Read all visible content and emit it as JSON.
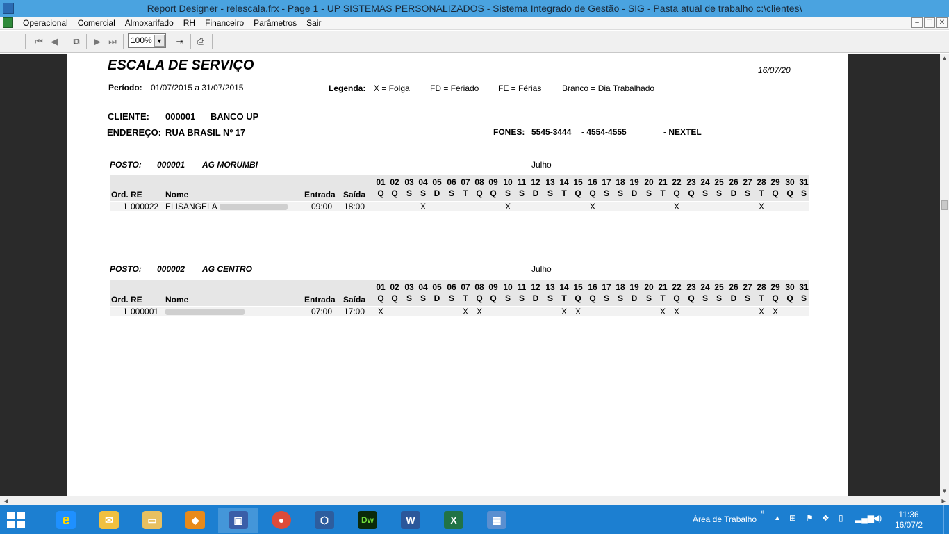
{
  "window": {
    "title": "Report Designer - relescala.frx - Page 1 - UP SISTEMAS PERSONALIZADOS - Sistema Integrado de Gestão - SIG - Pasta atual de trabalho c:\\clientes\\"
  },
  "menu": {
    "items": [
      "Operacional",
      "Comercial",
      "Almoxarifado",
      "RH",
      "Financeiro",
      "Parâmetros",
      "Sair"
    ]
  },
  "toolbar": {
    "zoom": "100%"
  },
  "report": {
    "title": "ESCALA DE SERVIÇO",
    "date": "16/07/20",
    "period_label": "Período:",
    "period_value": "01/07/2015 a 31/07/2015",
    "legend_label": "Legenda:",
    "legend_x": "X = Folga",
    "legend_fd": "FD = Feriado",
    "legend_fe": "FE = Férias",
    "legend_blank": "Branco = Dia Trabalhado",
    "client_label": "CLIENTE:",
    "client_code": "000001",
    "client_name": "BANCO UP",
    "address_label": "ENDEREÇO:",
    "address_value": "RUA BRASIL Nº 17",
    "phones_label": "FONES:",
    "phone_1": "5545-3444",
    "phone_2": "- 4554-4555",
    "phone_3": "- NEXTEL",
    "columns": {
      "ord_re": "Ord. RE",
      "nome": "Nome",
      "entrada": "Entrada",
      "saida": "Saída"
    },
    "days": [
      "01",
      "02",
      "03",
      "04",
      "05",
      "06",
      "07",
      "08",
      "09",
      "10",
      "11",
      "12",
      "13",
      "14",
      "15",
      "16",
      "17",
      "18",
      "19",
      "20",
      "21",
      "22",
      "23",
      "24",
      "25",
      "26",
      "27",
      "28",
      "29",
      "30",
      "31"
    ],
    "weekdays": [
      "Q",
      "Q",
      "S",
      "S",
      "D",
      "S",
      "T",
      "Q",
      "Q",
      "S",
      "S",
      "D",
      "S",
      "T",
      "Q",
      "Q",
      "S",
      "S",
      "D",
      "S",
      "T",
      "Q",
      "Q",
      "S",
      "S",
      "D",
      "S",
      "T",
      "Q",
      "Q",
      "S"
    ],
    "postos": [
      {
        "label": "POSTO:",
        "code": "000001",
        "name": "AG MORUMBI",
        "month": "Julho",
        "row": {
          "ord": "1",
          "re": "000022",
          "nome": "ELISANGELA",
          "entrada": "09:00",
          "saida": "18:00",
          "folga": "X",
          "folga_days": [
            4,
            10,
            16,
            22,
            28
          ]
        }
      },
      {
        "label": "POSTO:",
        "code": "000002",
        "name": "AG CENTRO",
        "month": "Julho",
        "row": {
          "ord": "1",
          "re": "000001",
          "nome": "",
          "entrada": "07:00",
          "saida": "17:00",
          "folga": "X",
          "folga_days": [
            1,
            7,
            8,
            14,
            15,
            21,
            22,
            28,
            29
          ]
        }
      }
    ]
  },
  "taskbar": {
    "area_label": "Área de Trabalho",
    "time": "11:36",
    "date": "16/07/2"
  }
}
